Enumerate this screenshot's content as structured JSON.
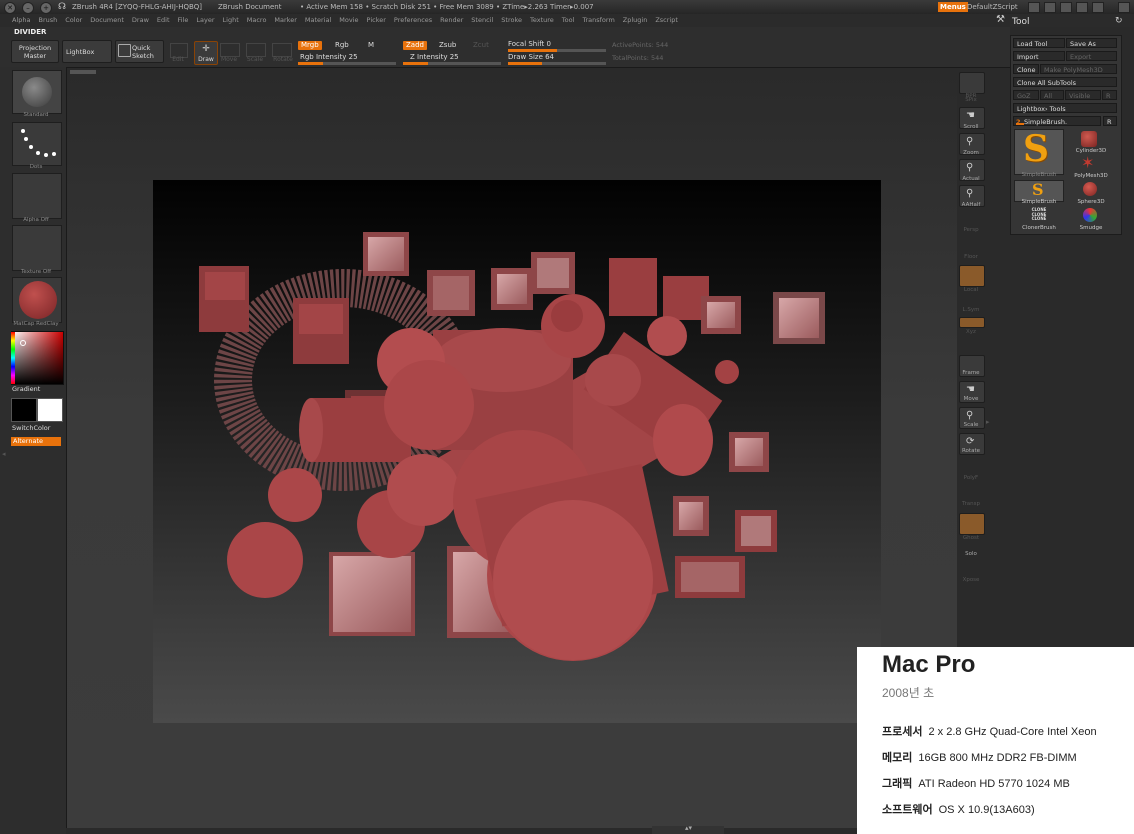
{
  "titlebar": {
    "app": "ZBrush 4R4 [ZYQQ-FHLG-AHIJ-HQBQ]",
    "document": "ZBrush Document",
    "stats": "• Active Mem 158 • Scratch Disk 251 • Free Mem 3089 • ZTime▸2.263 Timer▸0.007",
    "menus_btn": "Menus",
    "script": "DefaultZScript"
  },
  "menubar": [
    "Alpha",
    "Brush",
    "Color",
    "Document",
    "Draw",
    "Edit",
    "File",
    "Layer",
    "Light",
    "Macro",
    "Marker",
    "Material",
    "Movie",
    "Picker",
    "Preferences",
    "Render",
    "Stencil",
    "Stroke",
    "Texture",
    "Tool",
    "Transform",
    "Zplugin",
    "Zscript"
  ],
  "shelf": {
    "divider": "DIVIDER",
    "projection_master": "Projection Master",
    "lightbox": "LightBox",
    "quick_sketch": "Quick Sketch",
    "edit": "Edit",
    "draw": "Draw",
    "move": "Move",
    "scale": "Scale",
    "rotate": "Rotate",
    "mrgb": "Mrgb",
    "rgb": "Rgb",
    "m": "M",
    "rgb_intensity": "Rgb Intensity 25",
    "zadd": "Zadd",
    "zsub": "Zsub",
    "zcut": "Zcut",
    "z_intensity": "Z Intensity 25",
    "focal_shift": "Focal Shift 0",
    "draw_size": "Draw Size 64",
    "active_points": "ActivePoints: 544",
    "total_points": "TotalPoints: 544",
    "rgb_intensity_value": 0.25,
    "z_intensity_value": 0.25,
    "focal_shift_value": 0.5,
    "draw_size_value": 0.35
  },
  "lefttray": {
    "standard": "Standard",
    "dots": "Dots",
    "alpha_off": "Alpha Off",
    "texture_off": "Texture Off",
    "matcap": "MatCap RedClay",
    "gradient": "Gradient",
    "switchcolor": "SwitchColor",
    "alternate": "Alternate"
  },
  "righttools": {
    "bpr": "BPR",
    "spix": "SPix",
    "scroll": "Scroll",
    "zoom": "Zoom",
    "actual": "Actual",
    "aahalf": "AAHalf",
    "persp": "Persp",
    "floor": "Floor",
    "local": "Local",
    "lsym": "L.Sym",
    "xyz": "Xyz",
    "frame": "Frame",
    "move": "Move",
    "scale": "Scale",
    "rotate": "Rotate",
    "polyf": "PolyF",
    "transp": "Transp",
    "ghost": "Ghost",
    "solo": "Solo",
    "xpose": "Xpose"
  },
  "tool": {
    "title": "Tool",
    "load_tool": "Load Tool",
    "save_as": "Save As",
    "import": "Import",
    "export": "Export",
    "clone": "Clone",
    "make_polymesh": "Make PolyMesh3D",
    "clone_all_subtools": "Clone All SubTools",
    "goz": "GoZ",
    "all": "All",
    "visible": "Visible",
    "r_small": "R",
    "lightbox_tools": "Lightbox› Tools",
    "current_tool": "SimpleBrush.",
    "current_tool_count": "2",
    "r_btn": "R",
    "items": [
      "SimpleBrush",
      "Cylinder3D",
      "PolyMesh3D",
      "SimpleBrush",
      "Sphere3D",
      "ClonerBrush",
      "Smudge"
    ],
    "cloner_label": "CLONE CLONE CLONE"
  },
  "spec": {
    "model": "Mac Pro",
    "year": "2008년 초",
    "rows": [
      {
        "k": "프로세서",
        "v": "2 x 2.8 GHz Quad-Core Intel Xeon"
      },
      {
        "k": "메모리",
        "v": "16GB 800 MHz DDR2 FB-DIMM"
      },
      {
        "k": "그래픽",
        "v": "ATI Radeon HD 5770 1024 MB"
      },
      {
        "k": "소프트웨어",
        "v": "OS X 10.9(13A603)"
      }
    ]
  },
  "colors": {
    "accent": "#e8720c",
    "clay": "#a13a3c",
    "clay_light": "#c98a8c"
  }
}
